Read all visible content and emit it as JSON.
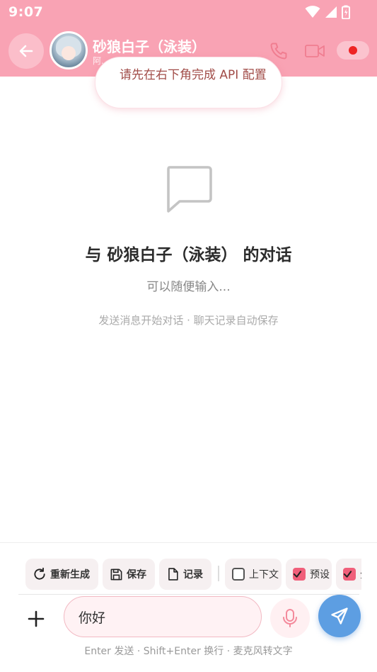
{
  "status_bar": {
    "time": "9:07"
  },
  "header": {
    "title": "砂狼白子（泳装）",
    "subtitle": "阿..."
  },
  "toast": {
    "message": "请先在右下角完成 API 配置"
  },
  "empty_state": {
    "title": "与 砂狼白子（泳装） 的对话",
    "subtitle": "可以随便输入...",
    "hint": "发送消息开始对话 · 聊天记录自动保存"
  },
  "toolbar": {
    "regenerate": "重新生成",
    "save": "保存",
    "records": "记录",
    "context": "上下文",
    "preset": "预设",
    "more_partial": "分"
  },
  "composer": {
    "input_value": "你好",
    "hint": "Enter 发送 · Shift+Enter 换行 · 麦克风转文字"
  },
  "colors": {
    "header": "#f9a3b4",
    "accent": "#f05f7a",
    "send": "#5d9ee2",
    "toast_text": "#a14c48"
  },
  "icons": [
    "wifi-icon",
    "signal-icon",
    "battery-icon",
    "back-arrow-icon",
    "phone-icon",
    "video-icon",
    "record-dot-icon",
    "chat-bubble-icon",
    "refresh-icon",
    "save-icon",
    "file-icon",
    "plus-icon",
    "mic-icon",
    "send-icon"
  ]
}
